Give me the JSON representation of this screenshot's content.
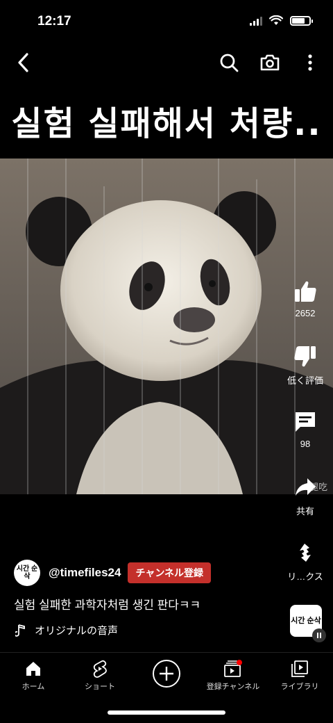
{
  "status": {
    "time": "12:17",
    "battery_level": 0.8
  },
  "top_bar": {
    "back_icon": "chevron-left-icon",
    "search_icon": "search-icon",
    "camera_icon": "camera-icon",
    "more_icon": "more-vert-icon"
  },
  "video": {
    "title_overlay": "실험 실패해서 처량..",
    "watermark": "腿吃",
    "like_count": "2652",
    "dislike_label": "低く評価",
    "comment_count": "98",
    "share_label": "共有",
    "remix_label": "リ…クス"
  },
  "channel": {
    "avatar_text": "시간 순삭",
    "handle": "@timefiles24",
    "subscribe_label": "チャンネル登録",
    "caption": "실험 실패한 과학자처럼 생긴 판다ㅋㅋ",
    "sound_label": "オリジナルの音声",
    "sound_avatar_text": "시간 순삭"
  },
  "nav": {
    "items": [
      {
        "label": "ホーム",
        "icon": "home-icon"
      },
      {
        "label": "ショート",
        "icon": "shorts-icon"
      },
      {
        "label": "",
        "icon": "create-plus-icon"
      },
      {
        "label": "登録チャンネル",
        "icon": "subscriptions-icon"
      },
      {
        "label": "ライブラリ",
        "icon": "library-icon"
      }
    ]
  },
  "colors": {
    "subscribe_red": "#c4302b",
    "background": "#000000"
  }
}
